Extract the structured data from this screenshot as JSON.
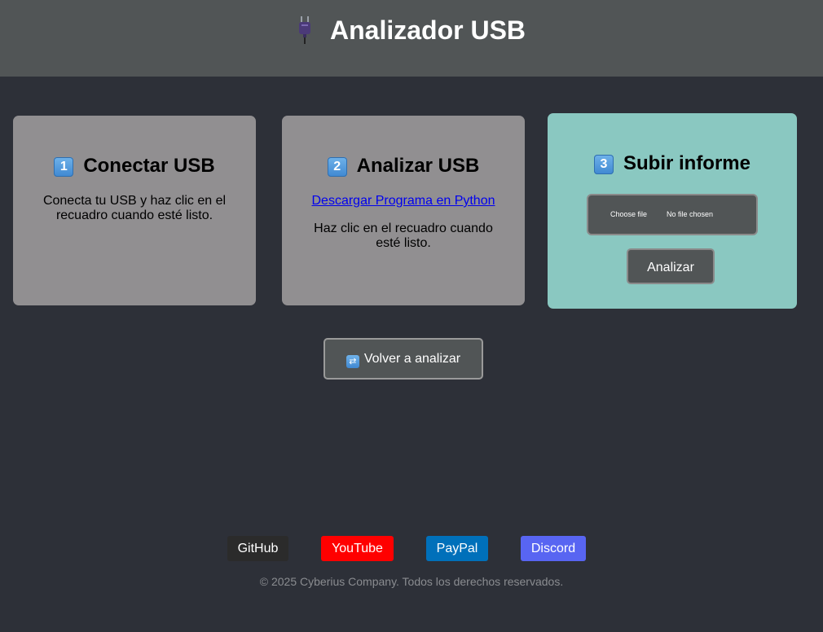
{
  "header": {
    "title": "Analizador USB",
    "icon": "electric-plug-icon"
  },
  "steps": [
    {
      "number": "1",
      "title": "Conectar USB",
      "text": "Conecta tu USB y haz clic en el recuadro cuando esté listo."
    },
    {
      "number": "2",
      "title": "Analizar USB",
      "link": "Descargar Programa en Python",
      "text": "Haz clic en el recuadro cuando esté listo."
    },
    {
      "number": "3",
      "title": "Subir informe",
      "file_button": "Choose file",
      "file_status": "No file chosen",
      "button": "Analizar"
    }
  ],
  "retry_button": "Volver a analizar",
  "retry_icon": "repeat-arrows-icon",
  "footer": {
    "links": [
      {
        "label": "GitHub",
        "color": "#2b2b2b"
      },
      {
        "label": "YouTube",
        "color": "#ff0000"
      },
      {
        "label": "PayPal",
        "color": "#0070ba"
      },
      {
        "label": "Discord",
        "color": "#5865f2"
      }
    ],
    "copyright": "© 2025 Cyberius Company. Todos los derechos reservados."
  },
  "colors": {
    "background": "#2d3038",
    "header": "#515556",
    "card": "#918f91",
    "card_active": "#8ac8c1"
  }
}
